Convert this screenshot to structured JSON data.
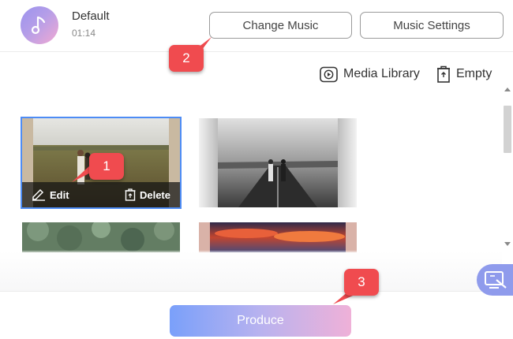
{
  "header": {
    "track_title": "Default",
    "track_duration": "01:14",
    "change_music_label": "Change Music",
    "music_settings_label": "Music Settings",
    "avatar_icon": "music-note-icon"
  },
  "toolbar": {
    "media_library_label": "Media Library",
    "media_library_icon": "play-square-icon",
    "empty_label": "Empty",
    "empty_icon": "trash-icon"
  },
  "media": {
    "items": [
      {
        "name": "couple-field-photo",
        "selected": true
      },
      {
        "name": "couple-road-photo",
        "selected": false
      },
      {
        "name": "forest-aerial-photo",
        "selected": false
      },
      {
        "name": "sunset-clouds-photo",
        "selected": false
      }
    ],
    "edit_label": "Edit",
    "delete_label": "Delete"
  },
  "footer": {
    "produce_label": "Produce"
  },
  "annotations": [
    "1",
    "2",
    "3"
  ],
  "colors": {
    "selection_border": "#4d8cf5",
    "callout": "#f04b4f",
    "produce_gradient_start": "#7aa0fa",
    "produce_gradient_end": "#efb1d8"
  }
}
